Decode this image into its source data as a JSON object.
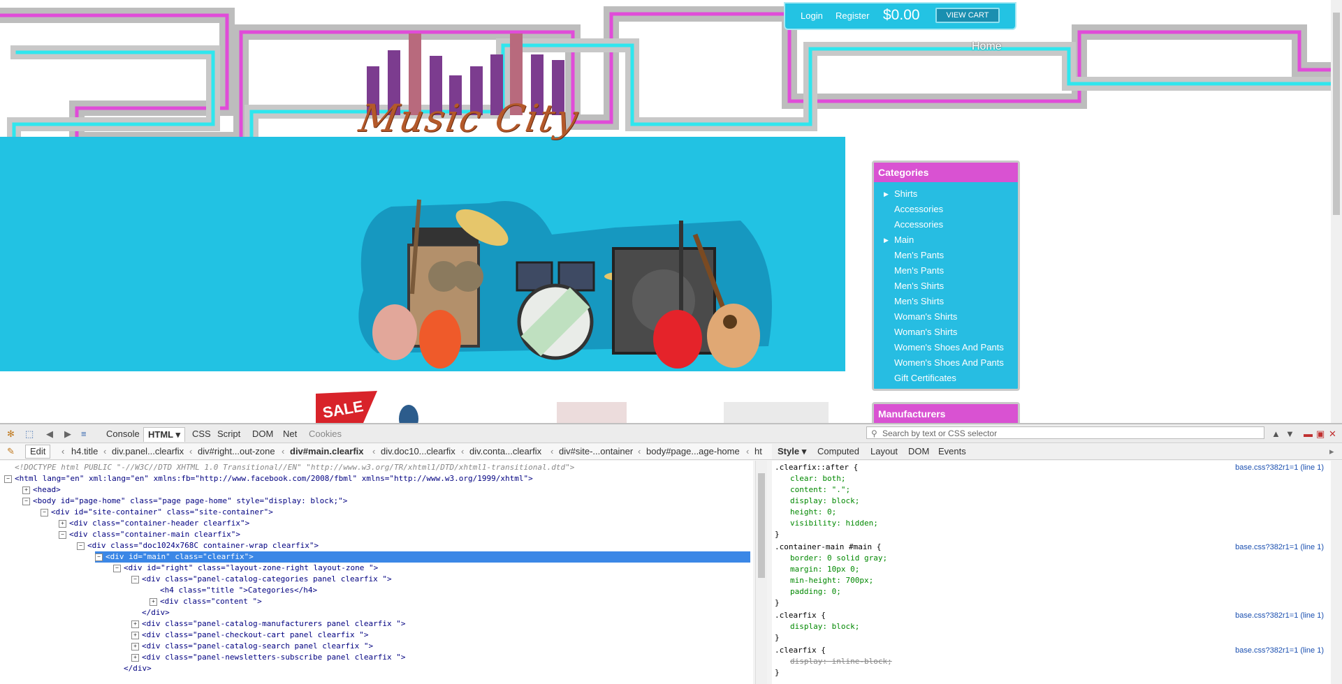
{
  "site": {
    "logo_text": "Music City",
    "topbar": {
      "login": "Login",
      "register": "Register",
      "cart_total": "$0.00",
      "view_cart": "VIEW CART"
    },
    "nav": {
      "home": "Home"
    },
    "categories": {
      "title": "Categories",
      "items": [
        {
          "label": "Shirts",
          "arrow": true
        },
        {
          "label": "Accessories",
          "arrow": false
        },
        {
          "label": "Accessories",
          "arrow": false
        },
        {
          "label": "Main",
          "arrow": true
        },
        {
          "label": "Men's Pants",
          "arrow": false
        },
        {
          "label": "Men's Pants",
          "arrow": false
        },
        {
          "label": "Men's Shirts",
          "arrow": false
        },
        {
          "label": "Men's Shirts",
          "arrow": false
        },
        {
          "label": "Woman's Shirts",
          "arrow": false
        },
        {
          "label": "Woman's Shirts",
          "arrow": false
        },
        {
          "label": "Women's Shoes And Pants",
          "arrow": false
        },
        {
          "label": "Women's Shoes And Pants",
          "arrow": false
        },
        {
          "label": "Gift Certificates",
          "arrow": false
        }
      ]
    },
    "manufacturers": {
      "title": "Manufacturers"
    },
    "sale_badge": "SALE"
  },
  "devtools": {
    "tabs": [
      "Console",
      "HTML",
      "CSS",
      "Script",
      "DOM",
      "Net",
      "Cookies"
    ],
    "active_tab": "HTML",
    "search_placeholder": "Search by text or CSS selector",
    "edit_label": "Edit",
    "breadcrumbs": [
      "h4.title",
      "div.panel...clearfix",
      "div#right...out-zone",
      "div#main.clearfix",
      "div.doc10...clearfix",
      "div.conta...clearfix",
      "div#site-...ontainer",
      "body#page...age-home",
      "ht"
    ],
    "side_tabs": [
      "Style",
      "Computed",
      "Layout",
      "DOM",
      "Events"
    ],
    "html_lines": [
      {
        "indent": 0,
        "exp": "",
        "text": "<!DOCTYPE html PUBLIC \"-//W3C//DTD XHTML 1.0 Transitional//EN\" \"http://www.w3.org/TR/xhtml1/DTD/xhtml1-transitional.dtd\">",
        "kind": "cmt"
      },
      {
        "indent": 0,
        "exp": "-",
        "text": "<html lang=\"en\" xml:lang=\"en\" xmlns:fb=\"http://www.facebook.com/2008/fbml\" xmlns=\"http://www.w3.org/1999/xhtml\">"
      },
      {
        "indent": 1,
        "exp": "+",
        "text": "<head>"
      },
      {
        "indent": 1,
        "exp": "-",
        "text": "<body id=\"page-home\" class=\"page page-home\" style=\"display: block;\">"
      },
      {
        "indent": 2,
        "exp": "-",
        "text": "<div id=\"site-container\" class=\"site-container\">"
      },
      {
        "indent": 3,
        "exp": "+",
        "text": "<div class=\"container-header clearfix\">"
      },
      {
        "indent": 3,
        "exp": "-",
        "text": "<div class=\"container-main clearfix\">"
      },
      {
        "indent": 4,
        "exp": "-",
        "text": "<div class=\"doc1024x768C container-wrap clearfix\">"
      },
      {
        "indent": 5,
        "exp": "-",
        "text": "<div id=\"main\" class=\"clearfix\">",
        "selected": true
      },
      {
        "indent": 6,
        "exp": "-",
        "text": "<div id=\"right\" class=\"layout-zone-right layout-zone \">"
      },
      {
        "indent": 7,
        "exp": "-",
        "text": "<div class=\"panel-catalog-categories panel clearfix \">"
      },
      {
        "indent": 8,
        "exp": "",
        "text": "<h4 class=\"title \">Categories</h4>"
      },
      {
        "indent": 8,
        "exp": "+",
        "text": "<div class=\"content \">"
      },
      {
        "indent": 7,
        "exp": "",
        "text": "</div>"
      },
      {
        "indent": 7,
        "exp": "+",
        "text": "<div class=\"panel-catalog-manufacturers panel clearfix \">"
      },
      {
        "indent": 7,
        "exp": "+",
        "text": "<div class=\"panel-checkout-cart panel clearfix \">"
      },
      {
        "indent": 7,
        "exp": "+",
        "text": "<div class=\"panel-catalog-search panel clearfix \">"
      },
      {
        "indent": 7,
        "exp": "+",
        "text": "<div class=\"panel-newsletters-subscribe panel clearfix \">"
      },
      {
        "indent": 6,
        "exp": "",
        "text": "</div>"
      }
    ],
    "css_rules": [
      {
        "selector": ".clearfix::after {",
        "source": "base.css?382r1=1 (line 1)",
        "props": [
          "clear: both;",
          "content: \".\";",
          "display: block;",
          "height: 0;",
          "visibility: hidden;"
        ],
        "strike": false
      },
      {
        "selector": ".container-main #main {",
        "source": "base.css?382r1=1 (line 1)",
        "props": [
          "border: 0 solid gray;",
          "margin: 10px 0;",
          "min-height: 700px;",
          "padding: 0;"
        ],
        "strike": false
      },
      {
        "selector": ".clearfix {",
        "source": "base.css?382r1=1 (line 1)",
        "props": [
          "display: block;"
        ],
        "strike": false
      },
      {
        "selector": ".clearfix {",
        "source": "base.css?382r1=1 (line 1)",
        "props": [
          "display: inline-block;"
        ],
        "strike": true
      }
    ]
  },
  "colors": {
    "banner": "#22c2e3",
    "accent_pink": "#d952d2",
    "selection": "#3b87e6"
  }
}
